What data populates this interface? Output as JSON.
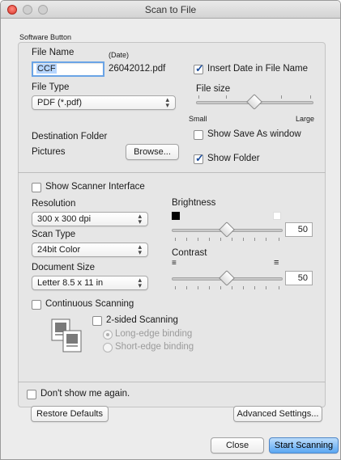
{
  "window": {
    "title": "Scan to File"
  },
  "section_label": "Software Button",
  "file_name": {
    "label": "File Name",
    "date_hint": "(Date)",
    "value": "CCF",
    "date_suffix": "26042012.pdf",
    "insert_date_label": "Insert Date in File Name",
    "insert_date_checked": true
  },
  "file_type": {
    "label": "File Type",
    "selected": "PDF (*.pdf)"
  },
  "file_size": {
    "label": "File size",
    "min_label": "Small",
    "max_label": "Large",
    "level": 0.5
  },
  "destination": {
    "label": "Destination Folder",
    "folder": "Pictures",
    "browse_label": "Browse...",
    "show_save_as_label": "Show Save As window",
    "show_save_as_checked": false,
    "show_folder_label": "Show Folder",
    "show_folder_checked": true
  },
  "scanner_interface": {
    "label": "Show Scanner Interface",
    "checked": false
  },
  "resolution": {
    "label": "Resolution",
    "selected": "300 x 300 dpi"
  },
  "scan_type": {
    "label": "Scan Type",
    "selected": "24bit Color"
  },
  "document_size": {
    "label": "Document Size",
    "selected": "Letter 8.5 x 11 in"
  },
  "brightness": {
    "label": "Brightness",
    "value": "50"
  },
  "contrast": {
    "label": "Contrast",
    "value": "50"
  },
  "continuous_scanning": {
    "label": "Continuous Scanning",
    "checked": false
  },
  "two_sided": {
    "label": "2-sided Scanning",
    "checked": false,
    "long_edge_label": "Long-edge binding",
    "short_edge_label": "Short-edge binding"
  },
  "dont_show": {
    "label": "Don't show me again.",
    "checked": false
  },
  "buttons": {
    "restore_defaults": "Restore Defaults",
    "advanced_settings": "Advanced Settings...",
    "close": "Close",
    "start_scanning": "Start Scanning"
  },
  "colors": {
    "accent": "#5aa7f2",
    "check": "#1c4d9c"
  }
}
